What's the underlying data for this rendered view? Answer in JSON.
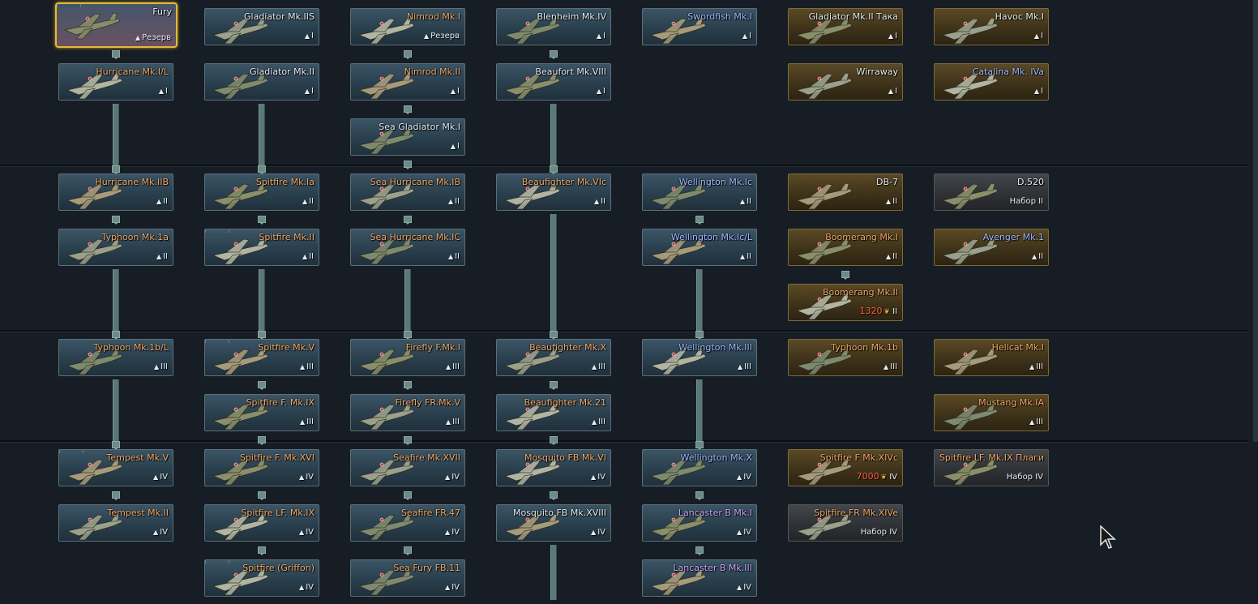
{
  "cards": [
    {
      "name": "Fury",
      "rank": "Резерв",
      "color": "white",
      "style": "sel",
      "folder": true
    },
    {
      "name": "Gladiator Mk.IIS",
      "rank": "I",
      "color": "white",
      "style": "tech"
    },
    {
      "name": "Nimrod Mk.I",
      "rank": "Резерв",
      "color": "orange",
      "style": "tech"
    },
    {
      "name": "Blenheim Mk.IV",
      "rank": "I",
      "color": "white",
      "style": "tech"
    },
    {
      "name": "Swordfish Mk.I",
      "rank": "I",
      "color": "blue",
      "style": "tech"
    },
    {
      "name": "Gladiator Mk.II Така",
      "rank": "I",
      "color": "white",
      "style": "premium"
    },
    {
      "name": "Havoc Mk.I",
      "rank": "I",
      "color": "white",
      "style": "premium"
    },
    {
      "name": "Hurricane Mk.I/L",
      "rank": "I",
      "color": "orange",
      "style": "tech"
    },
    {
      "name": "Gladiator Mk.II",
      "rank": "I",
      "color": "white",
      "style": "tech"
    },
    {
      "name": "Nimrod Mk.II",
      "rank": "I",
      "color": "orange",
      "style": "tech"
    },
    {
      "name": "Beaufort Mk.VIII",
      "rank": "I",
      "color": "white",
      "style": "tech"
    },
    {
      "name": "Wirraway",
      "rank": "I",
      "color": "white",
      "style": "premium"
    },
    {
      "name": "Catalina Mk. IVa",
      "rank": "I",
      "color": "blue",
      "style": "premium"
    },
    {
      "name": "Sea Gladiator Mk.I",
      "rank": "I",
      "color": "white",
      "style": "tech"
    },
    {
      "name": "Hurricane Mk.IIB",
      "rank": "II",
      "color": "orange",
      "style": "tech"
    },
    {
      "name": "Spitfire Mk.Ia",
      "rank": "II",
      "color": "orange",
      "style": "tech"
    },
    {
      "name": "Sea Hurricane Mk.IB",
      "rank": "II",
      "color": "orange",
      "style": "tech"
    },
    {
      "name": "Beaufighter Mk.VIc",
      "rank": "II",
      "color": "orange",
      "style": "tech"
    },
    {
      "name": "Wellington Mk.Ic",
      "rank": "II",
      "color": "blue",
      "style": "tech"
    },
    {
      "name": "DB-7",
      "rank": "II",
      "color": "white",
      "style": "premium"
    },
    {
      "name": "D.520",
      "rank": "Набор II",
      "color": "white",
      "style": "gray"
    },
    {
      "name": "Typhoon Mk.1a",
      "rank": "II",
      "color": "orange",
      "style": "tech"
    },
    {
      "name": "Spitfire Mk.II",
      "rank": "II",
      "color": "orange",
      "style": "tech",
      "folder": true
    },
    {
      "name": "Sea Hurricane Mk.IC",
      "rank": "II",
      "color": "orange",
      "style": "tech"
    },
    {
      "name": "Wellington Mk.Ic/L",
      "rank": "II",
      "color": "blue",
      "style": "tech"
    },
    {
      "name": "Boomerang Mk.I",
      "rank": "II",
      "color": "orange",
      "style": "premium"
    },
    {
      "name": "Avenger Mk.1",
      "rank": "II",
      "color": "blue",
      "style": "premium"
    },
    {
      "name": "Boomerang Mk.II",
      "rank": "II",
      "color": "orange",
      "style": "premium",
      "price": "1320"
    },
    {
      "name": "Typhoon Mk.1b/L",
      "rank": "III",
      "color": "orange",
      "style": "tech"
    },
    {
      "name": "Spitfire Mk.V",
      "rank": "III",
      "color": "orange",
      "style": "tech",
      "folder": true
    },
    {
      "name": "Firefly F.Mk.I",
      "rank": "III",
      "color": "orange",
      "style": "tech"
    },
    {
      "name": "Beaufighter Mk.X",
      "rank": "III",
      "color": "orange",
      "style": "tech"
    },
    {
      "name": "Wellington Mk.III",
      "rank": "III",
      "color": "blue",
      "style": "tech"
    },
    {
      "name": "Typhoon Mk.1b",
      "rank": "III",
      "color": "orange",
      "style": "premium"
    },
    {
      "name": "Hellcat Mk.I",
      "rank": "III",
      "color": "orange",
      "style": "premium"
    },
    {
      "name": "Spitfire F. Mk.IX",
      "rank": "III",
      "color": "orange",
      "style": "tech"
    },
    {
      "name": "Firefly FR.Mk.V",
      "rank": "III",
      "color": "orange",
      "style": "tech"
    },
    {
      "name": "Beaufighter Mk.21",
      "rank": "III",
      "color": "orange",
      "style": "tech"
    },
    {
      "name": "Mustang Mk.IA",
      "rank": "III",
      "color": "orange",
      "style": "premium"
    },
    {
      "name": "Tempest Mk.V",
      "rank": "IV",
      "color": "orange",
      "style": "tech",
      "folder": true
    },
    {
      "name": "Spitfire F. Mk.XVI",
      "rank": "IV",
      "color": "orange",
      "style": "tech"
    },
    {
      "name": "Seafire Mk.XVII",
      "rank": "IV",
      "color": "orange",
      "style": "tech"
    },
    {
      "name": "Mosquito FB Mk.VI",
      "rank": "IV",
      "color": "orange",
      "style": "tech"
    },
    {
      "name": "Wellington Mk.X",
      "rank": "IV",
      "color": "blue",
      "style": "tech"
    },
    {
      "name": "Spitfire F Mk.XIVc",
      "rank": "IV",
      "color": "orange",
      "style": "premium",
      "price": "7000"
    },
    {
      "name": "Spitfire LF. Mk.IX Плаги",
      "rank": "Набор IV",
      "color": "orange",
      "style": "gray"
    },
    {
      "name": "Tempest Mk.II",
      "rank": "IV",
      "color": "orange",
      "style": "tech"
    },
    {
      "name": "Spitfire LF. Mk.IX",
      "rank": "IV",
      "color": "orange",
      "style": "tech"
    },
    {
      "name": "Seafire FR.47",
      "rank": "IV",
      "color": "orange",
      "style": "tech"
    },
    {
      "name": "Mosquito FB Mk.XVIII",
      "rank": "IV",
      "color": "white",
      "style": "tech"
    },
    {
      "name": "Lancaster B Mk.I",
      "rank": "IV",
      "color": "purple",
      "style": "tech"
    },
    {
      "name": "Spitfire FR Mk.XIVe",
      "rank": "Набор IV",
      "color": "orange",
      "style": "gray"
    },
    {
      "name": "Spitfire (Griffon)",
      "rank": "IV",
      "color": "orange",
      "style": "tech",
      "folder": true
    },
    {
      "name": "Sea Fury FB.11",
      "rank": "IV",
      "color": "orange",
      "style": "tech"
    },
    {
      "name": "Lancaster B Mk.III",
      "rank": "IV",
      "color": "purple",
      "style": "tech"
    }
  ]
}
